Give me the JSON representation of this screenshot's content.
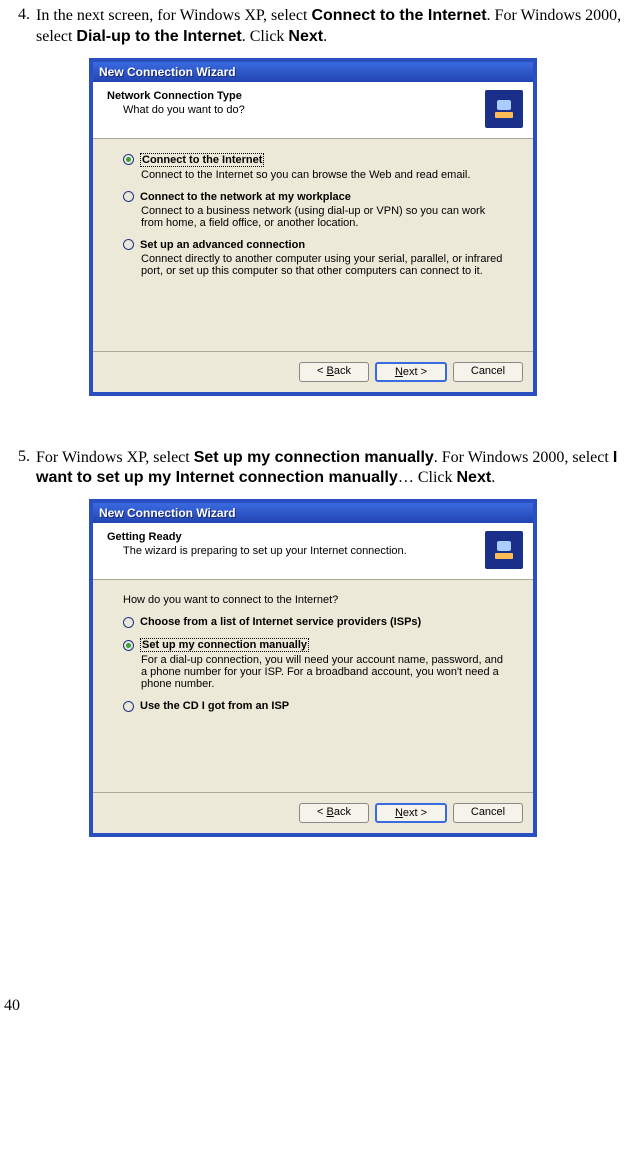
{
  "step4": {
    "num": "4.",
    "t1": "In the next screen, for Windows XP, select ",
    "b1": "Connect to the Internet",
    "t2": ". For Windows 2000, select ",
    "b2": "Dial-up to the Internet",
    "t3": ". Click ",
    "b3": "Next",
    "t4": "."
  },
  "step5": {
    "num": "5.",
    "t1": "For Windows XP, select ",
    "b1": "Set up my connection manually",
    "t2": ". For Windows 2000, select ",
    "b2": "I want to set up my Internet connection manually",
    "t3": "… Click ",
    "b3": "Next",
    "t4": "."
  },
  "wiz1": {
    "title": "New Connection Wizard",
    "header_title": "Network Connection Type",
    "header_sub": "What do you want to do?",
    "opts": [
      {
        "label": "Connect to the Internet",
        "desc": "Connect to the Internet so you can browse the Web and read email.",
        "selected": true
      },
      {
        "label": "Connect to the network at my workplace",
        "desc": "Connect to a business network (using dial-up or VPN) so you can work from home, a field office, or another location."
      },
      {
        "label": "Set up an advanced connection",
        "desc": "Connect directly to another computer using your serial, parallel, or infrared port, or set up this computer so that other computers can connect to it."
      }
    ]
  },
  "wiz2": {
    "title": "New Connection Wizard",
    "header_title": "Getting Ready",
    "header_sub": "The wizard is preparing to set up your Internet connection.",
    "question": "How do you want to connect to the Internet?",
    "opts": [
      {
        "label": "Choose from a list of Internet service providers (ISPs)"
      },
      {
        "label": "Set up my connection manually",
        "desc": "For a dial-up connection, you will need your account name, password, and a phone number for your ISP. For a broadband account, you won't need a phone number.",
        "selected": true
      },
      {
        "label": "Use the CD I got from an ISP"
      }
    ]
  },
  "buttons": {
    "back_b": "B",
    "back_rest": "ack",
    "next_n": "N",
    "next_rest": "ext >",
    "back_prefix": "< ",
    "cancel": "Cancel"
  },
  "pagenum": "40"
}
